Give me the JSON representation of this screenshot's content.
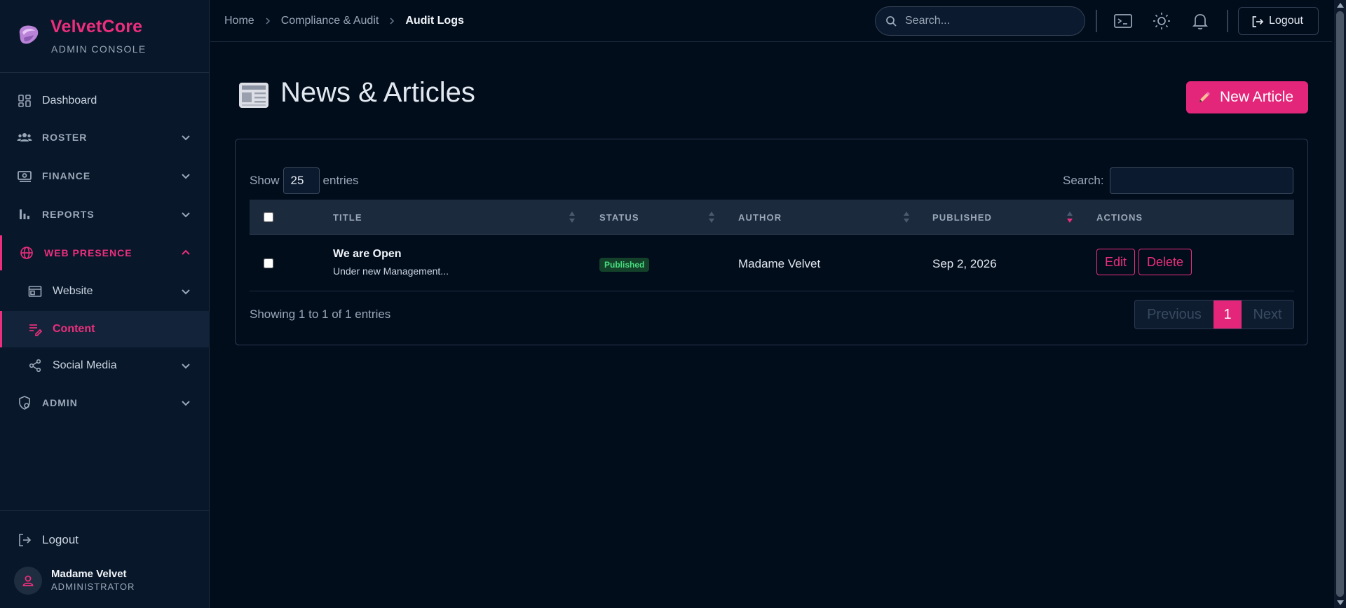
{
  "brand": {
    "name": "VelvetCore",
    "subtitle": "ADMIN CONSOLE"
  },
  "sidebar": {
    "items": [
      {
        "label": "Dashboard",
        "icon": "dashboard-icon"
      },
      {
        "label": "ROSTER",
        "icon": "users-icon"
      },
      {
        "label": "FINANCE",
        "icon": "cash-icon"
      },
      {
        "label": "REPORTS",
        "icon": "bar-chart-icon"
      },
      {
        "label": "WEB PRESENCE",
        "icon": "globe-icon",
        "active": true
      },
      {
        "label": "ADMIN",
        "icon": "shield-gear-icon"
      }
    ],
    "web_presence_children": [
      {
        "label": "Website",
        "icon": "browser-icon"
      },
      {
        "label": "Content",
        "icon": "edit-list-icon",
        "current": true
      },
      {
        "label": "Social Media",
        "icon": "share-icon"
      }
    ],
    "logout_label": "Logout",
    "user": {
      "name": "Madame Velvet",
      "role": "ADMINISTRATOR"
    }
  },
  "header": {
    "breadcrumbs": [
      "Home",
      "Compliance & Audit",
      "Audit Logs"
    ],
    "search_placeholder": "Search...",
    "logout_label": "Logout"
  },
  "page": {
    "title": "News & Articles",
    "new_button_label": "New Article"
  },
  "table": {
    "show_label": "Show",
    "page_size": "25",
    "entries_label": "entries",
    "search_label": "Search:",
    "search_value": "",
    "columns": [
      "TITLE",
      "STATUS",
      "AUTHOR",
      "PUBLISHED",
      "ACTIONS"
    ],
    "sorted_column": "PUBLISHED",
    "rows": [
      {
        "title": "We are Open",
        "subtitle": "Under new Management...",
        "status": "Published",
        "author": "Madame Velvet",
        "published": "Sep 2, 2026",
        "edit_label": "Edit",
        "delete_label": "Delete"
      }
    ],
    "showing_text": "Showing 1 to 1 of 1 entries",
    "pagination": {
      "previous": "Previous",
      "current": "1",
      "next": "Next"
    }
  },
  "colors": {
    "accent": "#ec2e7c",
    "background": "#020d1c",
    "sidebar": "#08172a",
    "status_published": "#4ade80"
  }
}
